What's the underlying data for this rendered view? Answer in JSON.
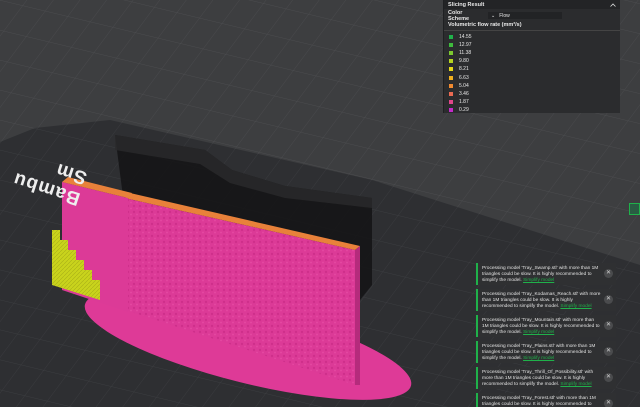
{
  "viewport": {
    "bed_brand_text": "Bambu Sm",
    "colors": {
      "background": "#3d3e40",
      "grid": "#4c4d50",
      "bed": "#2c2d30",
      "model_magenta": "#dc3a97",
      "model_orange": "#e8813a",
      "model_yellow": "#c9d31c",
      "shadow_body": "#1c1c1e",
      "accent": "#1fb14a"
    }
  },
  "slicing_panel": {
    "title": "Slicing Result",
    "color_scheme_label": "Color Scheme",
    "color_scheme_value": "Flow",
    "legend_title": "Volumetric flow rate (mm³/s)",
    "legend": [
      {
        "value": "14.55",
        "color": "#20b14a"
      },
      {
        "value": "12.97",
        "color": "#3fbb3d"
      },
      {
        "value": "11.38",
        "color": "#7cc92f"
      },
      {
        "value": "9.80",
        "color": "#b5d421"
      },
      {
        "value": "8.21",
        "color": "#e4d81a"
      },
      {
        "value": "6.63",
        "color": "#f2b11f"
      },
      {
        "value": "5.04",
        "color": "#f08a30"
      },
      {
        "value": "3.46",
        "color": "#ea6a52"
      },
      {
        "value": "1.87",
        "color": "#e0468a"
      },
      {
        "value": "0.29",
        "color": "#c42bc9"
      }
    ]
  },
  "notifications": [
    {
      "prefix": "Processing model 'Tray_Swamp.stl' with more than 1M triangles could be slow. It is highly recommended to simplify the model.",
      "link": "Simplify model"
    },
    {
      "prefix": "Processing model 'Tray_Kodamas_Reach.stl' with more than 1M triangles could be slow. It is highly recommended to simplify the model.",
      "link": "Simplify model"
    },
    {
      "prefix": "Processing model 'Tray_Mountain.stl' with more than 1M triangles could be slow. It is highly recommended to simplify the model.",
      "link": "Simplify model"
    },
    {
      "prefix": "Processing model 'Tray_Plains.stl' with more than 1M triangles could be slow. It is highly recommended to simplify the model.",
      "link": "Simplify model"
    },
    {
      "prefix": "Processing model 'Tray_Thrill_Of_Possibility.stl' with more than 1M triangles could be slow. It is highly recommended to simplify the model.",
      "link": "Simplify model"
    },
    {
      "prefix": "Processing model 'Tray_Forest.stl' with more than 1M triangles could be slow. It is highly recommended to",
      "link": ""
    }
  ]
}
